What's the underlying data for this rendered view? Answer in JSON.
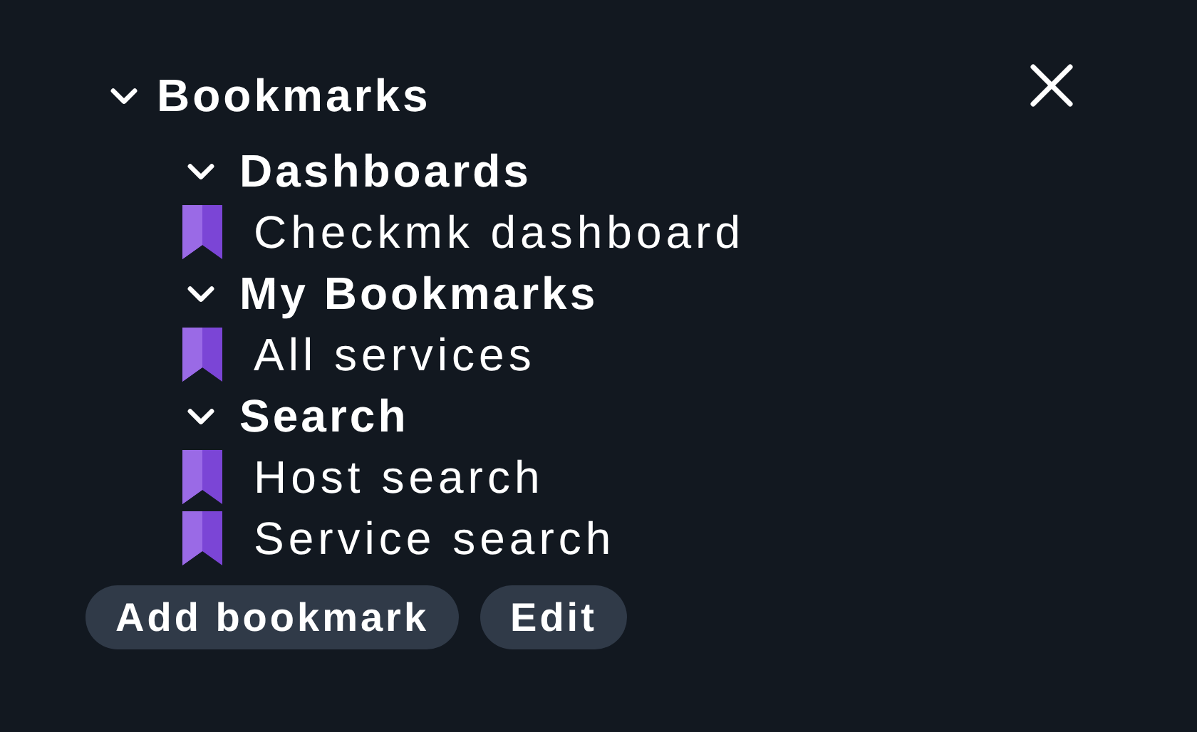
{
  "snapin": {
    "title": "Bookmarks",
    "expanded": true
  },
  "groups": [
    {
      "title": "Dashboards",
      "expanded": true,
      "items": [
        "Checkmk dashboard"
      ]
    },
    {
      "title": "My Bookmarks",
      "expanded": true,
      "items": [
        "All services"
      ]
    },
    {
      "title": "Search",
      "expanded": true,
      "items": [
        "Host search",
        "Service search"
      ]
    }
  ],
  "buttons": [
    "Add bookmark",
    "Edit"
  ]
}
